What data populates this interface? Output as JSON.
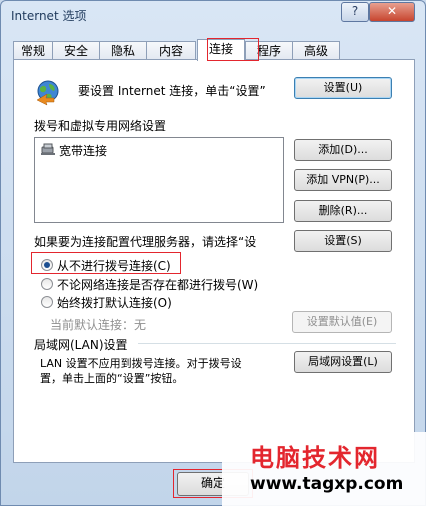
{
  "window": {
    "title": "Internet 选项",
    "help": "?",
    "close": "✕"
  },
  "tabs": [
    "常规",
    "安全",
    "隐私",
    "内容",
    "连接",
    "程序",
    "高级"
  ],
  "setup": {
    "text": "要设置 Internet 连接，单击“设置”",
    "button": "设置(U)"
  },
  "dialup": {
    "heading": "拨号和虚拟专用网络设置",
    "items": [
      "宽带连接"
    ],
    "add": "添加(D)...",
    "add_vpn": "添加 VPN(P)...",
    "remove": "删除(R)...",
    "proxy_text": "如果要为连接配置代理服务器，请选择“设",
    "settings": "设置(S)",
    "options": [
      "从不进行拨号连接(C)",
      "不论网络连接是否存在都进行拨号(W)",
      "始终拨打默认连接(O)"
    ],
    "selected": 0,
    "current_default_label": "当前默认连接：",
    "current_default_value": "无",
    "set_default": "设置默认值(E)"
  },
  "lan": {
    "heading": "局域网(LAN)设置",
    "text_line1": "LAN 设置不应用到拨号连接。对于拨号设",
    "text_line2": "置，单击上面的“设置”按钮。",
    "button": "局域网设置(L)"
  },
  "footer": {
    "ok": "确定"
  },
  "watermark": {
    "title": "电脑技术网",
    "url": "www.tagxp.com"
  }
}
